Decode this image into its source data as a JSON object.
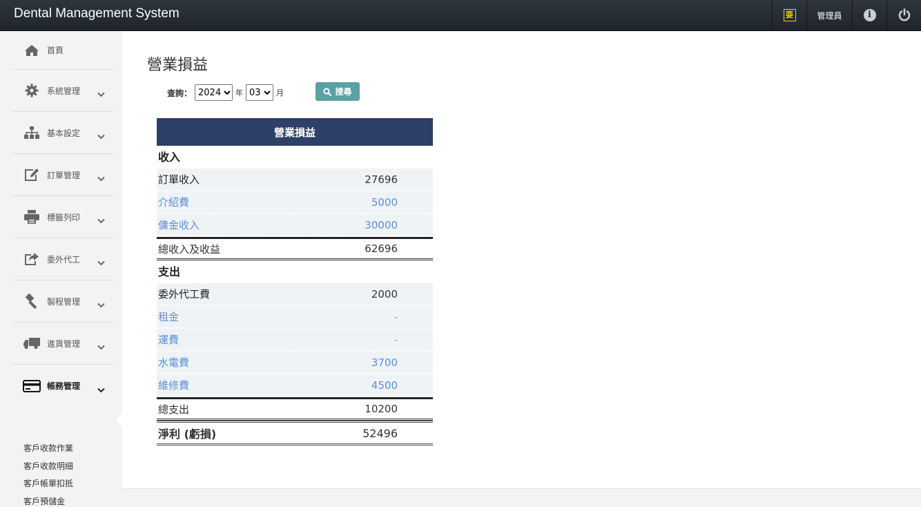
{
  "app": {
    "title": "Dental Management System",
    "topnav": {
      "ticket_icon_text": "耍",
      "user_label": "管理員"
    }
  },
  "sidebar": {
    "items": [
      {
        "label": "首頁",
        "icon": "home-icon"
      },
      {
        "label": "系統管理",
        "icon": "gear-icon"
      },
      {
        "label": "基本設定",
        "icon": "sitemap-icon"
      },
      {
        "label": "訂單管理",
        "icon": "edit-icon"
      },
      {
        "label": "標籤列印",
        "icon": "printer-icon"
      },
      {
        "label": "委外代工",
        "icon": "share-icon"
      },
      {
        "label": "製程管理",
        "icon": "gavel-icon"
      },
      {
        "label": "進貨管理",
        "icon": "truck-icon"
      },
      {
        "label": "帳務管理",
        "icon": "credit-card-icon"
      }
    ],
    "submenu": [
      "客戶收款作業",
      "客戶收款明細",
      "客戶帳單扣抵",
      "客戶預儲金"
    ]
  },
  "page": {
    "title": "營業損益",
    "query_label": "查詢：",
    "year_value": "2024",
    "year_unit": "年",
    "month_value": "03",
    "month_unit": "月",
    "search_label": "搜尋"
  },
  "report": {
    "header": "營業損益",
    "income_title": "收入",
    "income_rows": [
      {
        "label": "訂單收入",
        "value": "27696"
      },
      {
        "label": "介紹費",
        "value": "5000"
      },
      {
        "label": "傭金收入",
        "value": "30000"
      }
    ],
    "income_total": {
      "label": "總收入及收益",
      "value": "62696"
    },
    "expense_title": "支出",
    "expense_rows": [
      {
        "label": "委外代工費",
        "value": "2000"
      },
      {
        "label": "租金",
        "value": "-"
      },
      {
        "label": "運費",
        "value": "-"
      },
      {
        "label": "水電費",
        "value": "3700"
      },
      {
        "label": "維修費",
        "value": "4500"
      }
    ],
    "expense_total": {
      "label": "總支出",
      "value": "10200"
    },
    "net": {
      "label": "淨利 (虧損)",
      "value": "52496"
    }
  },
  "colors": {
    "topbar": "#262c33",
    "table_header": "#2d4068",
    "search_button": "#5aa0a4",
    "link_blue": "#5b8fd6"
  }
}
